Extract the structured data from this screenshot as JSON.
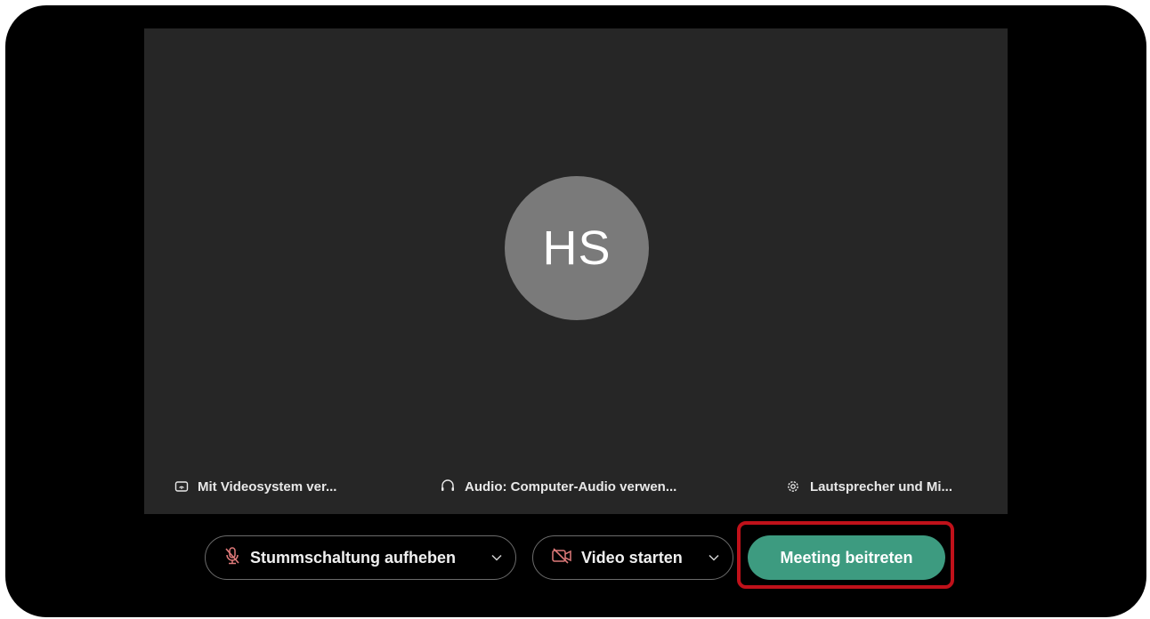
{
  "preview": {
    "avatar_initials": "HS"
  },
  "options": {
    "video_system": "Mit Videosystem ver...",
    "audio": "Audio: Computer-Audio verwen...",
    "speaker": "Lautsprecher und Mi..."
  },
  "controls": {
    "mute_label": "Stummschaltung aufheben",
    "video_label": "Video starten",
    "join_label": "Meeting beitreten"
  },
  "colors": {
    "join_button": "#3d9b80",
    "muted_icon": "#e07a7a",
    "highlight_border": "#c0111a"
  }
}
